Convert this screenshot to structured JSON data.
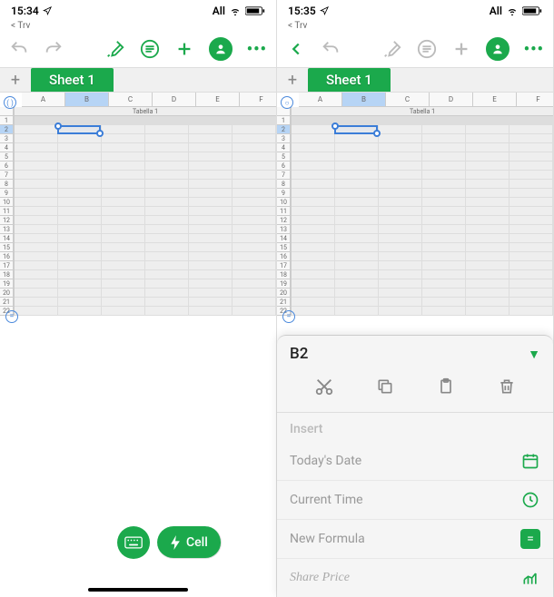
{
  "left": {
    "status": {
      "time": "15:34",
      "network": "All"
    },
    "try_label": "Trv",
    "sheet_tab": "Sheet 1",
    "table_title": "Tabella 1",
    "columns": [
      "A",
      "B",
      "C",
      "D",
      "E",
      "F"
    ],
    "rows": [
      "1",
      "2",
      "3",
      "4",
      "5",
      "6",
      "7",
      "8",
      "9",
      "10",
      "11",
      "12",
      "13",
      "14",
      "15",
      "16",
      "17",
      "18",
      "19",
      "20",
      "21",
      "22"
    ],
    "selected_col": "B",
    "selected_row": "2",
    "pills": {
      "cell_label": "Cell"
    }
  },
  "right": {
    "status": {
      "time": "15:35",
      "network": "All"
    },
    "try_label": "Trv",
    "sheet_tab": "Sheet 1",
    "table_title": "Tabella 1",
    "columns": [
      "A",
      "B",
      "C",
      "D",
      "E",
      "F"
    ],
    "rows": [
      "1",
      "2",
      "3",
      "4",
      "5",
      "6",
      "7",
      "8",
      "9",
      "10",
      "11",
      "12",
      "13",
      "14",
      "15",
      "16",
      "17",
      "18",
      "19",
      "20",
      "21",
      "22"
    ],
    "selected_col": "B",
    "selected_row": "2",
    "panel": {
      "cell_ref": "B2",
      "section_title": "Insert",
      "rows": {
        "today": "Today's Date",
        "time": "Current Time",
        "formula": "New Formula",
        "share": "Share Price"
      }
    }
  }
}
